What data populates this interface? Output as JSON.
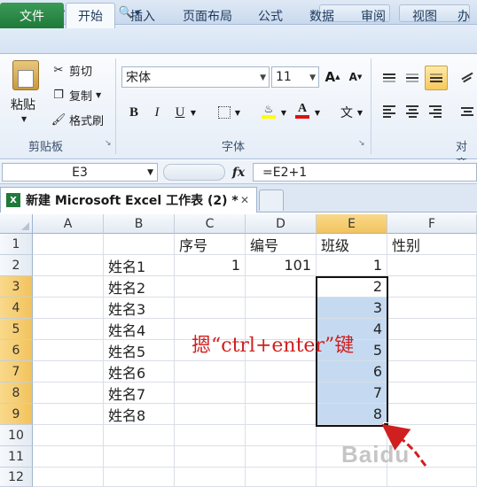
{
  "ribbon_tabs": [
    "文件",
    "开始",
    "插入",
    "页面布局",
    "公式",
    "数据",
    "审阅",
    "视图",
    "办"
  ],
  "clipboard": {
    "paste": "粘贴",
    "cut": "剪切",
    "copy": "复制",
    "format_painter": "格式刷",
    "group_label": "剪贴板"
  },
  "font": {
    "name": "宋体",
    "size": "11",
    "group_label": "字体",
    "grow": "A",
    "shrink": "A",
    "bold": "B",
    "italic": "I",
    "underline": "U",
    "font_color_letter": "A",
    "phonetic": "文"
  },
  "align": {
    "group_label": "对齐"
  },
  "formula_bar": {
    "name_box": "E3",
    "fx": "fx",
    "formula": "=E2+1"
  },
  "document_tab": {
    "title": "新建 Microsoft Excel 工作表 (2) *",
    "close": "✕"
  },
  "columns": [
    "A",
    "B",
    "C",
    "D",
    "E",
    "F"
  ],
  "rows": [
    "1",
    "2",
    "3",
    "4",
    "5",
    "6",
    "7",
    "8",
    "9",
    "10",
    "11",
    "12"
  ],
  "cells": {
    "C1": "序号",
    "D1": "编号",
    "E1": "班级",
    "F1": "性别",
    "B2": "姓名1",
    "C2": "1",
    "D2": "101",
    "E2": "1",
    "B3": "姓名2",
    "E3": "2",
    "B4": "姓名3",
    "E4": "3",
    "B5": "姓名4",
    "E5": "4",
    "B6": "姓名5",
    "E6": "5",
    "B7": "姓名6",
    "E7": "6",
    "B8": "姓名7",
    "E8": "7",
    "B9": "姓名8",
    "E9": "8"
  },
  "annotation": "摁“ctrl+enter”键",
  "watermark": "Baidu",
  "colors": {
    "file_tab": "#1f7a3a",
    "selection": "#c5daf1",
    "header_highlight": "#f2c35d",
    "annotation": "#d01f1f",
    "font_color_bar": "#e01010",
    "highlight_bar": "#ffff00"
  }
}
